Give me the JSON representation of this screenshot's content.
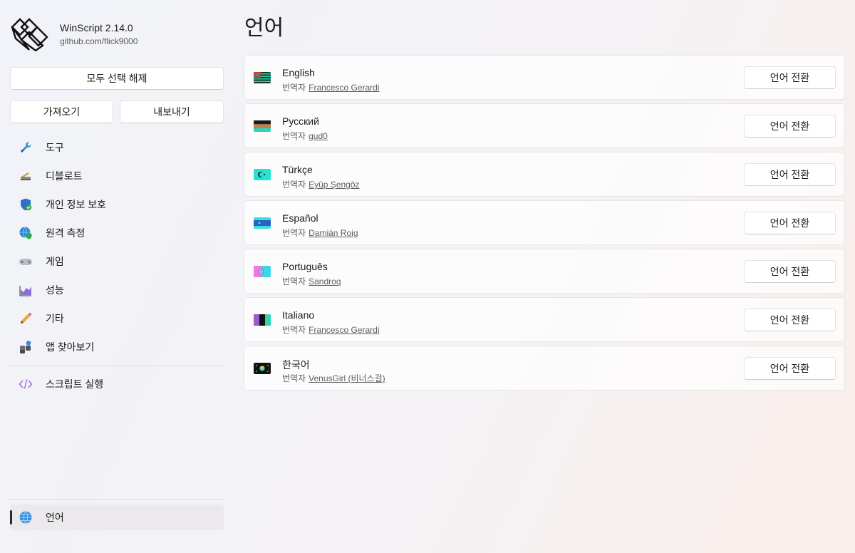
{
  "app": {
    "title": "WinScript 2.14.0",
    "subtitle": "github.com/flick9000"
  },
  "sidebar": {
    "deselect_all": "모두 선택 해제",
    "import": "가져오기",
    "export": "내보내기",
    "items": [
      {
        "label": "도구",
        "icon": "wrench-icon"
      },
      {
        "label": "디블로트",
        "icon": "broom-icon"
      },
      {
        "label": "개인 정보 보호",
        "icon": "shield-check-icon"
      },
      {
        "label": "원격 측정",
        "icon": "globe-shield-icon"
      },
      {
        "label": "게임",
        "icon": "gamepad-icon"
      },
      {
        "label": "성능",
        "icon": "chart-icon"
      },
      {
        "label": "기타",
        "icon": "pencil-icon"
      },
      {
        "label": "앱 찾아보기",
        "icon": "apps-icon"
      }
    ],
    "script": {
      "label": "스크립트 실행",
      "icon": "code-icon"
    },
    "language": {
      "label": "언어",
      "icon": "globe-icon"
    }
  },
  "main": {
    "title": "언어",
    "by_label": "번역자",
    "switch_label": "언어 전환",
    "languages": [
      {
        "name": "English",
        "translator": "Francesco Gerardi"
      },
      {
        "name": "Русский",
        "translator": "gud0"
      },
      {
        "name": "Türkçe",
        "translator": "Eyüp Şengöz"
      },
      {
        "name": "Español",
        "translator": "Damián Roig"
      },
      {
        "name": "Português",
        "translator": "Sandroq"
      },
      {
        "name": "Italiano",
        "translator": "Francesco Gerardi"
      },
      {
        "name": "한국어",
        "translator": "VenusGirl (비너스걸)"
      }
    ]
  },
  "colors": {
    "accent": "#2a2a2a",
    "card_border": "#e6e6e8",
    "selected_bg": "#ebe9ec"
  }
}
